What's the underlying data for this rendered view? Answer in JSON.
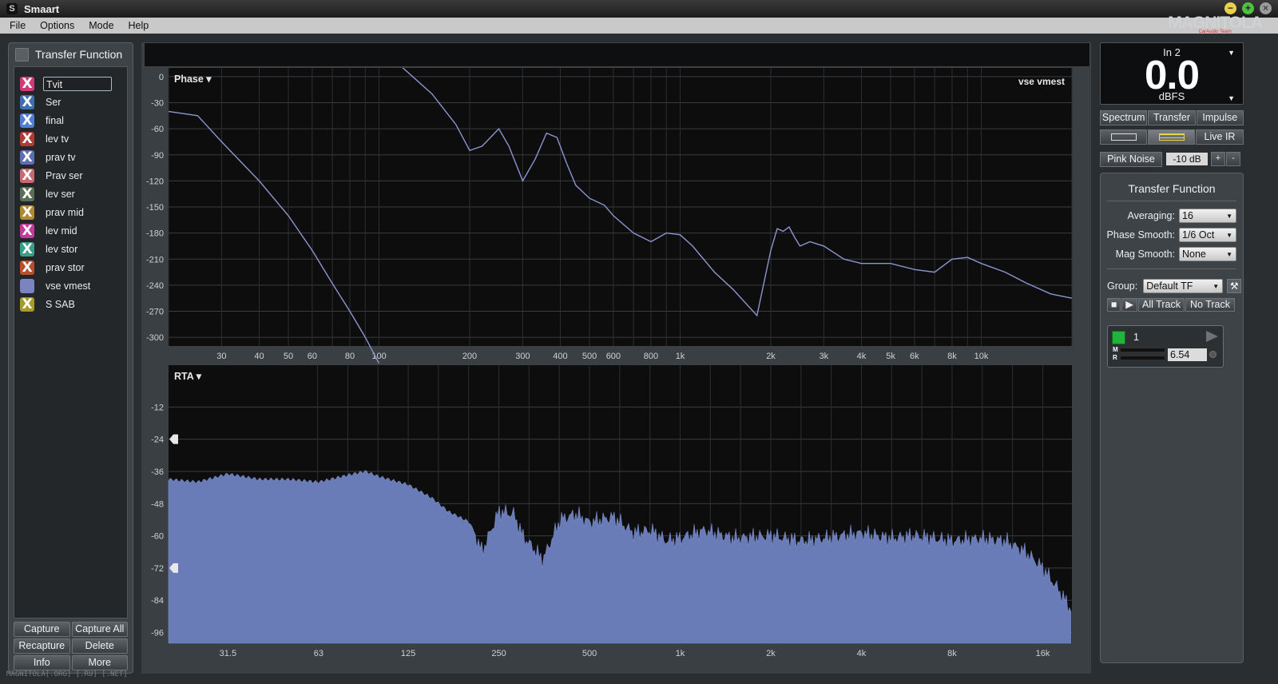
{
  "app": {
    "title": "Smaart",
    "icon_label": "S"
  },
  "window_buttons": {
    "min": "−",
    "max": "+",
    "close": "×"
  },
  "menu": [
    "File",
    "Options",
    "Mode",
    "Help"
  ],
  "logo": {
    "text": "MAGNITOLA",
    "sub": "CarAudio Team"
  },
  "left_panel": {
    "title": "Transfer Function",
    "traces": [
      {
        "name": "Tvit",
        "color": "#cf3a78",
        "mark": "X",
        "selected": true
      },
      {
        "name": "Ser",
        "color": "#3e6fb0",
        "mark": "X"
      },
      {
        "name": "final",
        "color": "#4f7fd2",
        "mark": "X"
      },
      {
        "name": "lev tv",
        "color": "#b23a32",
        "mark": "X"
      },
      {
        "name": "prav tv",
        "color": "#5d6fb2",
        "mark": "X"
      },
      {
        "name": "Prav ser",
        "color": "#c56b70",
        "mark": "X"
      },
      {
        "name": "lev ser",
        "color": "#5a6f55",
        "mark": "X"
      },
      {
        "name": "prav mid",
        "color": "#b08a32",
        "mark": "X"
      },
      {
        "name": "lev mid",
        "color": "#c23a9a",
        "mark": "X"
      },
      {
        "name": "lev stor",
        "color": "#3a9e8a",
        "mark": "X"
      },
      {
        "name": "prav stor",
        "color": "#b8502d",
        "mark": "X"
      },
      {
        "name": "vse vmest",
        "color": "#7b83c0",
        "mark": ""
      },
      {
        "name": "S SAB",
        "color": "#a59a2c",
        "mark": "X"
      }
    ],
    "buttons": {
      "capture": "Capture",
      "capture_all": "Capture All",
      "recapture": "Recapture",
      "delete": "Delete",
      "info": "Info",
      "more": "More"
    }
  },
  "watermark": "MAGNITOLA[.ORG] [.RU] [.NET]",
  "phase_plot": {
    "label": "Phase ▾",
    "trace_label": "vse vmest",
    "y_ticks": [
      0,
      -30,
      -60,
      -90,
      -120,
      -150,
      -180,
      -210,
      -240,
      -270,
      -300
    ],
    "x_ticks": [
      "30",
      "40",
      "50",
      "60",
      "80",
      "100",
      "200",
      "300",
      "400",
      "500",
      "600",
      "800",
      "1k",
      "2k",
      "3k",
      "4k",
      "5k",
      "6k",
      "8k",
      "10k"
    ],
    "x_tick_values": [
      30,
      40,
      50,
      60,
      80,
      100,
      200,
      300,
      400,
      500,
      600,
      800,
      1000,
      2000,
      3000,
      4000,
      5000,
      6000,
      8000,
      10000
    ]
  },
  "rta_plot": {
    "label": "RTA ▾",
    "y_ticks": [
      -12,
      -24,
      -36,
      -48,
      -60,
      -72,
      -84,
      -96
    ],
    "x_ticks": [
      "31.5",
      "63",
      "125",
      "250",
      "500",
      "1k",
      "2k",
      "4k",
      "8k",
      "16k"
    ],
    "x_tick_values": [
      31.5,
      63,
      125,
      250,
      500,
      1000,
      2000,
      4000,
      8000,
      16000
    ],
    "markers_db": [
      -24,
      -72
    ]
  },
  "chart_data": [
    {
      "type": "line",
      "ylabel": "Phase",
      "ylim": [
        -310,
        10
      ],
      "xlim": [
        20,
        20000
      ],
      "x_scale": "log",
      "series": [
        {
          "name": "vse vmest",
          "color": "#8d95cf",
          "x": [
            20,
            25,
            30,
            40,
            50,
            60,
            70,
            80,
            90,
            100,
            102,
            120,
            150,
            180,
            200,
            220,
            250,
            270,
            300,
            330,
            360,
            390,
            420,
            450,
            500,
            560,
            600,
            700,
            800,
            900,
            1000,
            1100,
            1300,
            1500,
            1800,
            2000,
            2100,
            2200,
            2300,
            2400,
            2500,
            2700,
            3000,
            3500,
            4000,
            5000,
            6000,
            7000,
            8000,
            9000,
            10000,
            12000,
            14000,
            17000,
            20000
          ],
          "y": [
            -40,
            -45,
            -75,
            -120,
            -160,
            -200,
            -238,
            -270,
            -300,
            -330,
            30,
            10,
            -20,
            -55,
            -85,
            -80,
            -60,
            -80,
            -120,
            -95,
            -65,
            -70,
            -100,
            -125,
            -140,
            -148,
            -160,
            -180,
            -190,
            -180,
            -182,
            -195,
            -225,
            -245,
            -275,
            -200,
            -175,
            -178,
            -173,
            -185,
            -195,
            -190,
            -195,
            -210,
            -215,
            -215,
            -222,
            -225,
            -210,
            -208,
            -215,
            -225,
            -237,
            -250,
            -255
          ]
        }
      ]
    },
    {
      "type": "area",
      "ylabel": "RTA",
      "ylim": [
        -100,
        0
      ],
      "xlim": [
        20,
        20000
      ],
      "x_scale": "log",
      "series": [
        {
          "name": "RTA",
          "color": "#6a7cb8",
          "x": [
            20,
            25,
            31.5,
            40,
            50,
            63,
            75,
            90,
            100,
            125,
            150,
            170,
            200,
            220,
            250,
            280,
            300,
            350,
            400,
            450,
            500,
            600,
            700,
            800,
            900,
            1000,
            1200,
            1500,
            2000,
            2500,
            3000,
            4000,
            5000,
            6000,
            8000,
            10000,
            12000,
            14000,
            16000,
            18000,
            20000
          ],
          "y": [
            -39,
            -40,
            -37,
            -39,
            -39,
            -40,
            -38,
            -36,
            -38,
            -41,
            -46,
            -51,
            -55,
            -66,
            -51,
            -52,
            -60,
            -69,
            -54,
            -52,
            -55,
            -53,
            -59,
            -58,
            -62,
            -61,
            -58,
            -61,
            -60,
            -62,
            -61,
            -59,
            -61,
            -60,
            -62,
            -61,
            -62,
            -66,
            -72,
            -80,
            -88
          ]
        }
      ]
    }
  ],
  "meter": {
    "channel": "In 2",
    "value": "0.0",
    "unit": "dBFS"
  },
  "modes": [
    "Spectrum",
    "Transfer",
    "Impulse"
  ],
  "live_ir": "Live IR",
  "noise": {
    "label": "Pink Noise",
    "level": "-10 dB",
    "plus": "+",
    "minus": "-"
  },
  "tf_panel": {
    "title": "Transfer Function",
    "averaging_label": "Averaging:",
    "averaging": "16",
    "phase_smooth_label": "Phase Smooth:",
    "phase_smooth": "1/6 Oct",
    "mag_smooth_label": "Mag Smooth:",
    "mag_smooth": "None",
    "group_label": "Group:",
    "group": "Default TF",
    "all_track": "All Track",
    "no_track": "No Track",
    "measurement": {
      "number": "1",
      "m": "M",
      "r": "R",
      "delay": "6.54"
    }
  }
}
